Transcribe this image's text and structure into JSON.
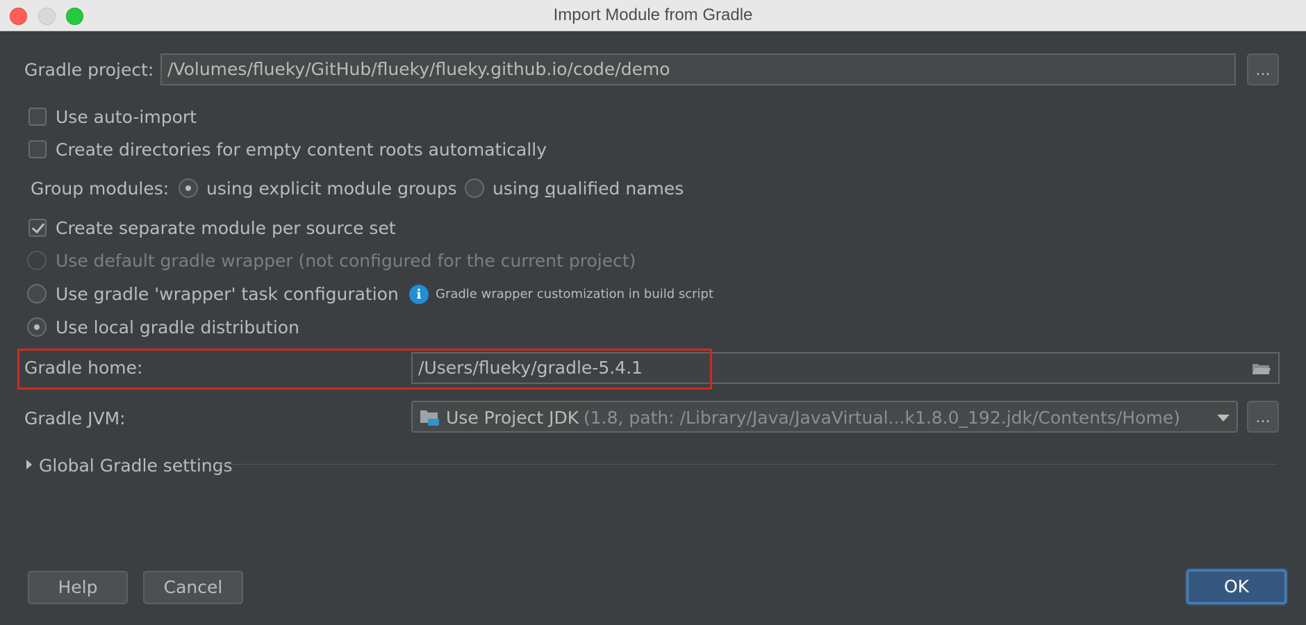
{
  "window": {
    "title": "Import Module from Gradle"
  },
  "gradle_project": {
    "label": "Gradle project:",
    "value": "/Volumes/flueky/GitHub/flueky/flueky.github.io/code/demo",
    "browse_label": "..."
  },
  "options": {
    "auto_import": {
      "label": "Use auto-import",
      "checked": false
    },
    "create_dirs": {
      "label": "Create directories for empty content roots automatically",
      "checked": false
    },
    "group_modules_label": "Group modules:",
    "group_explicit_pre": "using explicit module ",
    "group_explicit_u": "g",
    "group_explicit_post": "roups",
    "group_qualified_pre": "using ",
    "group_qualified_u": "q",
    "group_qualified_post": "ualified names",
    "separate_module": {
      "label": "Create separate module per source set",
      "checked": true
    },
    "default_wrapper": "Use default gradle wrapper (not configured for the current project)",
    "wrapper_task": "Use gradle 'wrapper' task configuration",
    "wrapper_hint": "Gradle wrapper customization in build script",
    "local_distribution": "Use local gradle distribution"
  },
  "gradle_home": {
    "label": "Gradle home:",
    "value": "/Users/flueky/gradle-5.4.1"
  },
  "gradle_jvm": {
    "label": "Gradle JVM:",
    "value_main": "Use Project JDK",
    "value_detail": " (1.8, path: /Library/Java/JavaVirtual...k1.8.0_192.jdk/Contents/Home)",
    "browse_label": "..."
  },
  "global_settings": {
    "label": "Global Gradle settings"
  },
  "footer": {
    "help": "Help",
    "cancel": "Cancel",
    "ok": "OK"
  },
  "colors": {
    "background": "#3c3f41",
    "field": "#45494a",
    "highlight": "#cc2b1f",
    "primary": "#365880",
    "info": "#1f8fd6"
  }
}
